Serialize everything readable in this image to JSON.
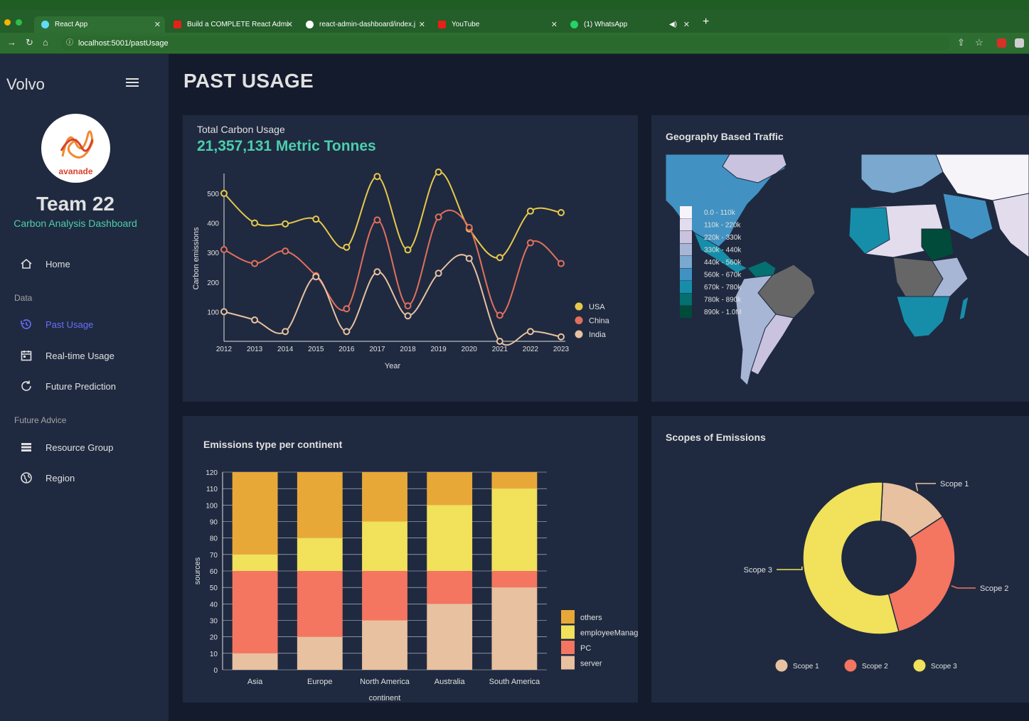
{
  "browser": {
    "tabs": [
      {
        "label": "React App",
        "active": true
      },
      {
        "label": "Build a COMPLETE React Admi",
        "active": false
      },
      {
        "label": "react-admin-dashboard/index.j",
        "active": false
      },
      {
        "label": "YouTube",
        "active": false
      },
      {
        "label": "(1) WhatsApp",
        "active": false
      }
    ],
    "url": "localhost:5001/pastUsage"
  },
  "sidebar": {
    "brand": "Volvo",
    "logo_text": "avanade",
    "team": "Team 22",
    "subtitle": "Carbon Analysis Dashboard",
    "items": [
      {
        "label": "Home",
        "icon": "home-icon"
      },
      {
        "section": "Data"
      },
      {
        "label": "Past Usage",
        "icon": "history-icon",
        "active": true
      },
      {
        "label": "Real-time Usage",
        "icon": "calendar-icon"
      },
      {
        "label": "Future Prediction",
        "icon": "refresh-icon"
      },
      {
        "section": "Future Advice"
      },
      {
        "label": "Resource Group",
        "icon": "storage-icon"
      },
      {
        "label": "Region",
        "icon": "globe-icon"
      }
    ]
  },
  "page": {
    "title": "PAST USAGE"
  },
  "carbon_panel": {
    "title": "Total Carbon Usage",
    "total": "21,357,131 Metric Tonnes"
  },
  "geo_panel": {
    "title": "Geography Based Traffic",
    "legend": [
      "0.0 - 110k",
      "110k - 220k",
      "220k - 330k",
      "330k - 440k",
      "440k - 560k",
      "560k - 670k",
      "670k - 780k",
      "780k - 890k",
      "890k - 1.0M"
    ],
    "legend_colors": [
      "#f7f4f9",
      "#e2dcec",
      "#c9c3df",
      "#a8b6d6",
      "#7aa8cf",
      "#4192c2",
      "#168eaa",
      "#04706f",
      "#004b3a"
    ]
  },
  "emissions_panel": {
    "title": "Emissions type per continent"
  },
  "scopes_panel": {
    "title": "Scopes of Emissions"
  },
  "chart_data": [
    {
      "type": "line",
      "xlabel": "Year",
      "ylabel": "Carbon emissions",
      "x": [
        2012,
        2013,
        2014,
        2015,
        2016,
        2017,
        2018,
        2019,
        2020,
        2021,
        2022,
        2023
      ],
      "yticks": [
        100,
        200,
        300,
        400,
        500
      ],
      "ylim": [
        0,
        560
      ],
      "legend": "right",
      "series": [
        {
          "name": "USA",
          "color": "#e8c84b",
          "values": [
            500,
            400,
            397,
            413,
            318,
            557,
            309,
            572,
            380,
            283,
            440,
            435
          ]
        },
        {
          "name": "China",
          "color": "#e2705c",
          "values": [
            310,
            263,
            305,
            222,
            110,
            410,
            120,
            420,
            385,
            88,
            333,
            263
          ]
        },
        {
          "name": "India",
          "color": "#e8c1a0",
          "values": [
            100,
            72,
            33,
            218,
            33,
            235,
            86,
            230,
            280,
            0,
            33,
            15
          ]
        }
      ]
    },
    {
      "type": "bar",
      "stacked": true,
      "xlabel": "continent",
      "ylabel": "sources",
      "categories": [
        "Asia",
        "Europe",
        "North America",
        "Australia",
        "South America"
      ],
      "yticks": [
        0,
        10,
        20,
        30,
        40,
        50,
        60,
        70,
        80,
        90,
        100,
        110,
        120
      ],
      "ylim": [
        0,
        120
      ],
      "legend": "right",
      "series": [
        {
          "name": "server",
          "color": "#e8c1a0",
          "values": [
            10,
            20,
            30,
            40,
            50
          ]
        },
        {
          "name": "PC",
          "color": "#f47560",
          "values": [
            50,
            40,
            30,
            20,
            10
          ]
        },
        {
          "name": "employeeManag",
          "color": "#f1e15b",
          "values": [
            10,
            20,
            30,
            40,
            50
          ]
        },
        {
          "name": "others",
          "color": "#e8a838",
          "values": [
            50,
            40,
            30,
            20,
            10
          ]
        }
      ]
    },
    {
      "type": "pie",
      "donut": true,
      "legend": "bottom",
      "series": [
        {
          "name": "Scope 1",
          "color": "#e8c1a0",
          "value": 15
        },
        {
          "name": "Scope 2",
          "color": "#f47560",
          "value": 30
        },
        {
          "name": "Scope 3",
          "color": "#f1e15b",
          "value": 55
        }
      ]
    }
  ]
}
